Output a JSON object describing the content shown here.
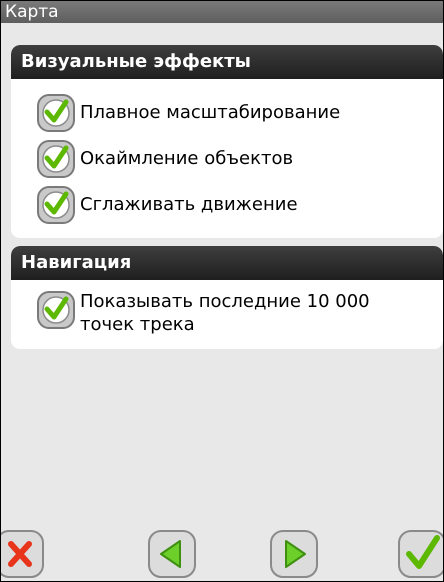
{
  "title": "Карта",
  "visual_effects": {
    "header": "Визуальные эффекты",
    "items": [
      {
        "label": "Плавное масштабирование",
        "checked": true
      },
      {
        "label": "Окаймление объектов",
        "checked": true
      },
      {
        "label": "Сглаживать движение",
        "checked": true
      }
    ]
  },
  "navigation": {
    "header": "Навигация",
    "items": [
      {
        "label_line1": "Показывать последние 10 000",
        "label_line2": "точек трека",
        "checked": true
      }
    ]
  },
  "toolbar": {
    "cancel_icon": "x-icon",
    "back_icon": "arrow-left-icon",
    "forward_icon": "arrow-right-icon",
    "ok_icon": "checkmark-icon"
  },
  "colors": {
    "header_bg": "#2b2b2b",
    "check_green": "#5cb800",
    "cancel_red": "#e8341a"
  }
}
